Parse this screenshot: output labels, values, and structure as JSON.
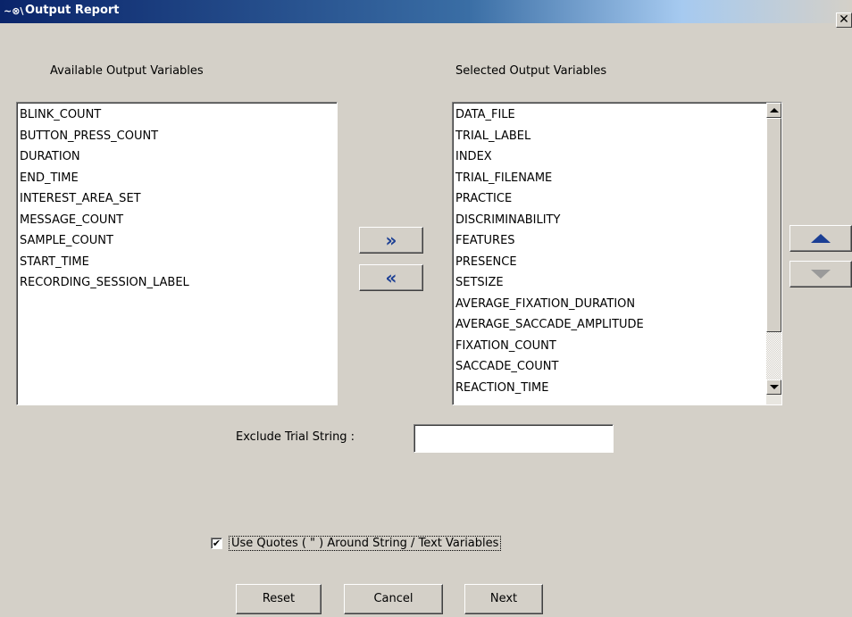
{
  "window": {
    "title": "Output Report",
    "icon_glyph": "~⊗\\",
    "close_glyph": "✕"
  },
  "available": {
    "label": "Available Output Variables",
    "items": [
      "BLINK_COUNT",
      "BUTTON_PRESS_COUNT",
      "DURATION",
      "END_TIME",
      "INTEREST_AREA_SET",
      "MESSAGE_COUNT",
      "SAMPLE_COUNT",
      "START_TIME",
      "RECORDING_SESSION_LABEL"
    ]
  },
  "selected": {
    "label": "Selected Output Variables",
    "items": [
      "DATA_FILE",
      "TRIAL_LABEL",
      "INDEX",
      "TRIAL_FILENAME",
      "PRACTICE",
      "DISCRIMINABILITY",
      "FEATURES",
      "PRESENCE",
      "SETSIZE",
      "AVERAGE_FIXATION_DURATION",
      "AVERAGE_SACCADE_AMPLITUDE",
      "FIXATION_COUNT",
      "SACCADE_COUNT",
      "REACTION_TIME"
    ]
  },
  "move_buttons": {
    "add_label": "»",
    "remove_label": "«"
  },
  "order_buttons": {
    "up_icon": "triangle-up",
    "down_icon": "triangle-down"
  },
  "exclude": {
    "label": "Exclude Trial String :",
    "value": ""
  },
  "quotes_option": {
    "label": "Use Quotes ( \" ) Around String /  Text Variables",
    "checked": true,
    "check_glyph": "✔"
  },
  "footer": {
    "reset_label": "Reset",
    "cancel_label": "Cancel",
    "next_label": "Next"
  },
  "colors": {
    "titlebar_start": "#0a246a",
    "titlebar_end": "#a6caf0",
    "dialog_bg": "#d4d0c8",
    "arrow_blue": "#1c3f94"
  }
}
